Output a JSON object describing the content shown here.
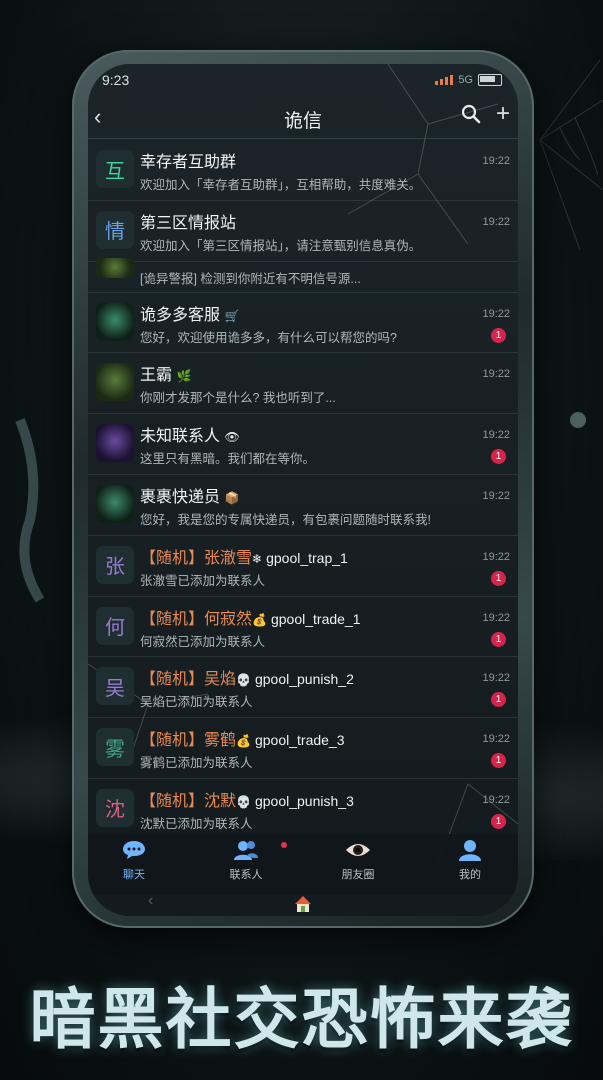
{
  "status": {
    "time": "9:23",
    "network": "5G"
  },
  "header": {
    "title": "诡信"
  },
  "chats": [
    {
      "avatar": "互",
      "avatar_color": "#3fd59e",
      "name": "幸存者互助群",
      "message": "欢迎加入「幸存者互助群」，互相帮助，共度难关。",
      "time": "19:22"
    },
    {
      "avatar": "情",
      "avatar_color": "#6aa0e8",
      "name": "第三区情报站",
      "message": "欢迎加入「第三区情报站」，请注意甄别信息真伪。",
      "time": "19:22"
    },
    {
      "message": "[诡异警报] 检测到你附近有不明信号源..."
    },
    {
      "name": "诡多多客服",
      "emoji": "🛒",
      "message": "您好，欢迎使用诡多多，有什么可以帮您的吗?",
      "time": "19:22",
      "badge": "1"
    },
    {
      "name": "王霸",
      "emoji": "🌿",
      "message": "你刚才发那个是什么? 我也听到了...",
      "time": "19:22"
    },
    {
      "name": "未知联系人",
      "emoji": "👁",
      "message": "这里只有黑暗。我们都在等你。",
      "time": "19:22",
      "badge": "1"
    },
    {
      "name": "裹裹快递员",
      "emoji": "📦",
      "message": "您好，我是您的专属快递员，有包裹问题随时联系我!",
      "time": "19:22"
    },
    {
      "avatar": "张",
      "avatar_color": "#9a7ad0",
      "tag": "【随机】",
      "name": "张澈雪",
      "emoji": "❄",
      "handle": "gpool_trap_1",
      "message": "张澈雪已添加为联系人",
      "time": "19:22",
      "badge": "1"
    },
    {
      "avatar": "何",
      "avatar_color": "#9a7ad0",
      "tag": "【随机】",
      "name": "何寂然",
      "emoji": "💰",
      "handle": "gpool_trade_1",
      "message": "何寂然已添加为联系人",
      "time": "19:22",
      "badge": "1"
    },
    {
      "avatar": "吴",
      "avatar_color": "#9a7ad0",
      "tag": "【随机】",
      "name": "吴焰",
      "emoji": "💀",
      "handle": "gpool_punish_2",
      "message": "吴焰已添加为联系人",
      "time": "19:22",
      "badge": "1"
    },
    {
      "avatar": "雾",
      "avatar_color": "#3fa888",
      "tag": "【随机】",
      "name": "雾鹤",
      "emoji": "💰",
      "handle": "gpool_trade_3",
      "message": "雾鹤已添加为联系人",
      "time": "19:22",
      "badge": "1"
    },
    {
      "avatar": "沈",
      "avatar_color": "#d86080",
      "tag": "【随机】",
      "name": "沈默",
      "emoji": "💀",
      "handle": "gpool_punish_3",
      "message": "沈默已添加为联系人",
      "time": "19:22",
      "badge": "1"
    }
  ],
  "tabs": [
    {
      "label": "聊天",
      "icon": "chat-bubble-icon"
    },
    {
      "label": "联系人",
      "icon": "contacts-icon"
    },
    {
      "label": "朋友圈",
      "icon": "eye-icon"
    },
    {
      "label": "我的",
      "icon": "profile-icon"
    }
  ],
  "slogan": "暗黑社交恐怖来袭"
}
